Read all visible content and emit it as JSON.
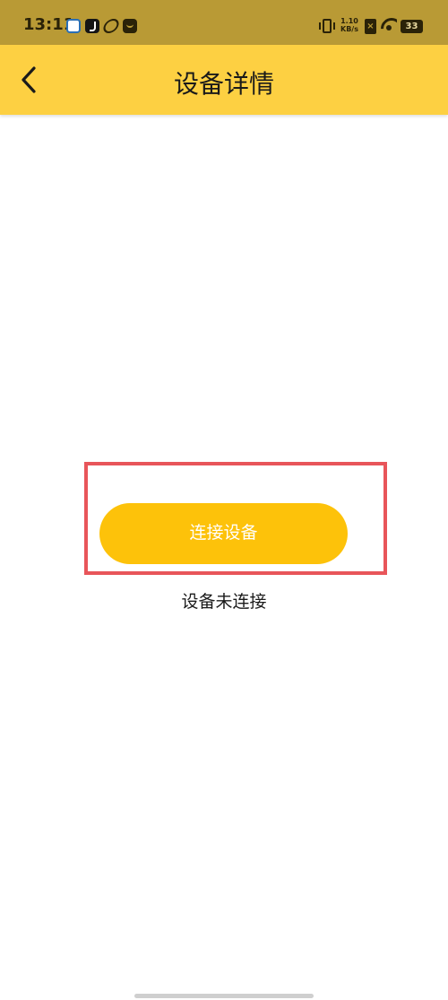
{
  "status_bar": {
    "time": "13:11",
    "notification_icons": [
      "app-icon",
      "tiktok-icon",
      "link-icon",
      "bag-icon"
    ],
    "net_speed_value": "1.10",
    "net_speed_unit": "KB/s",
    "sim_status": "×",
    "battery_level": "33"
  },
  "app_bar": {
    "title": "设备详情",
    "background_color": "#fdd042"
  },
  "main": {
    "connect_button_label": "连接设备",
    "connect_button_color": "#fdc20a",
    "connection_status": "设备未连接",
    "highlight_color": "#e8555a"
  }
}
